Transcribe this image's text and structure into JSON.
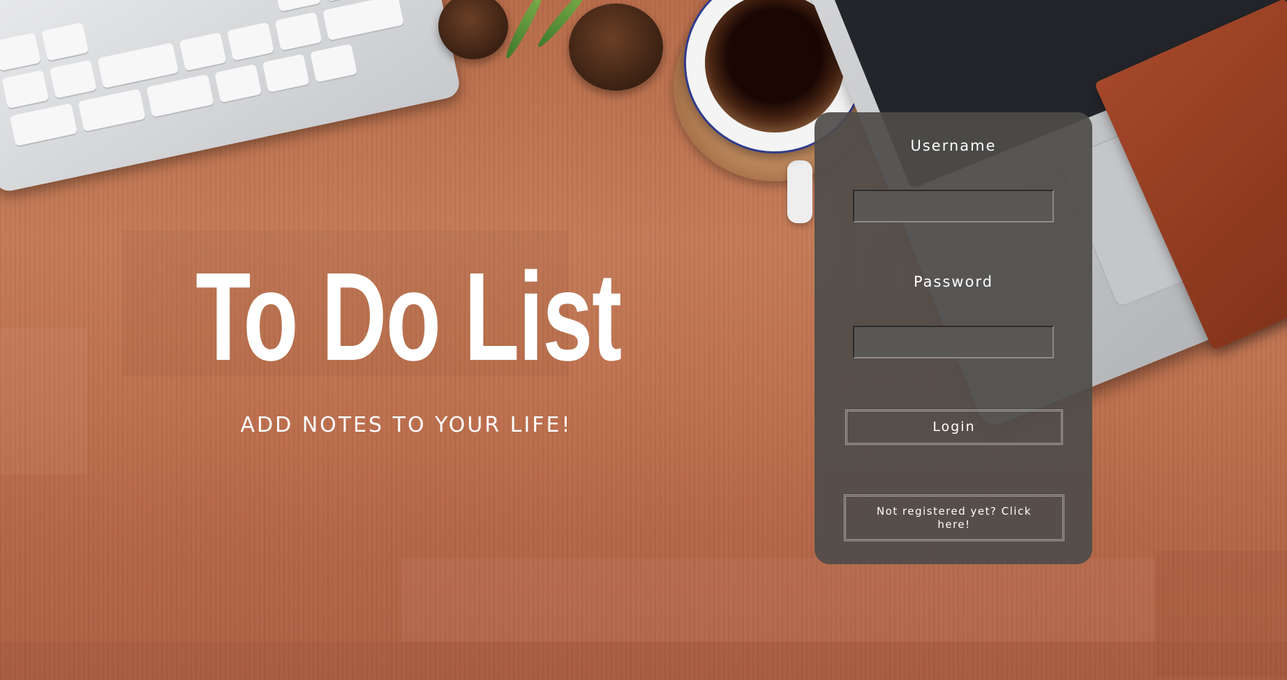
{
  "hero": {
    "title": "To Do List",
    "subtitle": "ADD NOTES TO YOUR LIFE!"
  },
  "login": {
    "username_label": "Username",
    "username_value": "",
    "password_label": "Password",
    "password_value": "",
    "login_button": "Login",
    "register_link": "Not registered yet? Click here!"
  },
  "colors": {
    "panel": "#4e4c4a",
    "text": "#ffffff",
    "desk": "#c37a57"
  }
}
